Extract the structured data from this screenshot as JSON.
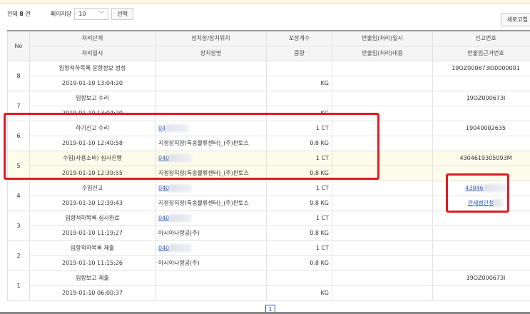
{
  "toolbar": {
    "total_prefix": "전체",
    "total_count": "8",
    "total_suffix": "건",
    "per_page_label": "페이지당",
    "per_page_value": "10",
    "select_button": "선택",
    "refresh_button": "새로고침"
  },
  "table": {
    "headers_top": [
      "No",
      "처리단계",
      "장치장/장치위치",
      "포장개수",
      "반출입(처리)일시",
      "신고번호"
    ],
    "headers_bottom": [
      "처리일시",
      "장치장명",
      "중량",
      "반출입(처리)내용",
      "반출입근거번호"
    ],
    "rows": [
      {
        "no": "8",
        "stage": "입항적하목록 운항정보 정정",
        "location": "",
        "pkg": "",
        "inout_dt": "",
        "report_no": "19OZ000673I00000001",
        "datetime": "2019-01-10 13:04:20",
        "warehouse": "",
        "weight": "KG",
        "inout_desc": "",
        "basis_no": ""
      },
      {
        "no": "7",
        "stage": "입항보고 수리",
        "location": "",
        "pkg": "",
        "inout_dt": "",
        "report_no": "19OZ000673I",
        "datetime": "2019-01-10 13:04:20",
        "warehouse": "",
        "weight": "KG",
        "inout_desc": "",
        "basis_no": ""
      },
      {
        "no": "6",
        "stage": "하기신고 수리",
        "location": "04",
        "pkg": "1 CT",
        "inout_dt": "",
        "report_no": "19040002635",
        "datetime": "2019-01-10 12:40:58",
        "warehouse": "지정장치장(특송물류센터)_(주)판토스",
        "weight": "0.8 KG",
        "inout_desc": "",
        "basis_no": ""
      },
      {
        "no": "5",
        "stage": "수입(사용소비) 심사진행",
        "location": "040",
        "pkg": "1 CT",
        "inout_dt": "",
        "report_no": "4304619305093M",
        "datetime": "2019-01-10 12:39:55",
        "warehouse": "지정장치장(특송물류센터)_(주)판토스",
        "weight": "0.8 KG",
        "inout_desc": "",
        "basis_no": "",
        "highlight": true
      },
      {
        "no": "4",
        "stage": "수입신고",
        "location": "040",
        "pkg": "1 CT",
        "inout_dt": "",
        "report_no": "43046",
        "report_link": true,
        "datetime": "2019-01-10 12:39:43",
        "warehouse": "지정장치장(특송물류센터)_(주)판토스",
        "weight": "0.8 KG",
        "inout_desc": "",
        "basis_no": "관세법인청",
        "basis_link": true
      },
      {
        "no": "3",
        "stage": "입항적하목록 심사완료",
        "location": "040",
        "pkg": "1 CT",
        "inout_dt": "",
        "report_no": "",
        "datetime": "2019-01-10 11:19:27",
        "warehouse": "아시아나항공(주)",
        "weight": "0.8 KG",
        "inout_desc": "",
        "basis_no": ""
      },
      {
        "no": "2",
        "stage": "입항적하목록 제출",
        "location": "040",
        "pkg": "1 CT",
        "inout_dt": "",
        "report_no": "",
        "datetime": "2019-01-10 11:15:26",
        "warehouse": "아시아나항공(주)",
        "weight": "0.8 KG",
        "inout_desc": "",
        "basis_no": ""
      },
      {
        "no": "1",
        "stage": "입항보고 제출",
        "location": "",
        "pkg": "",
        "inout_dt": "",
        "report_no": "19OZ000673I",
        "datetime": "2019-01-10 06:00:37",
        "warehouse": "",
        "weight": "KG",
        "inout_desc": "",
        "basis_no": ""
      }
    ]
  },
  "pager": {
    "current": "1"
  },
  "colors": {
    "highlight_box": "#e01b24",
    "link": "#2a56c6",
    "row_highlight": "#fdfbe9"
  }
}
